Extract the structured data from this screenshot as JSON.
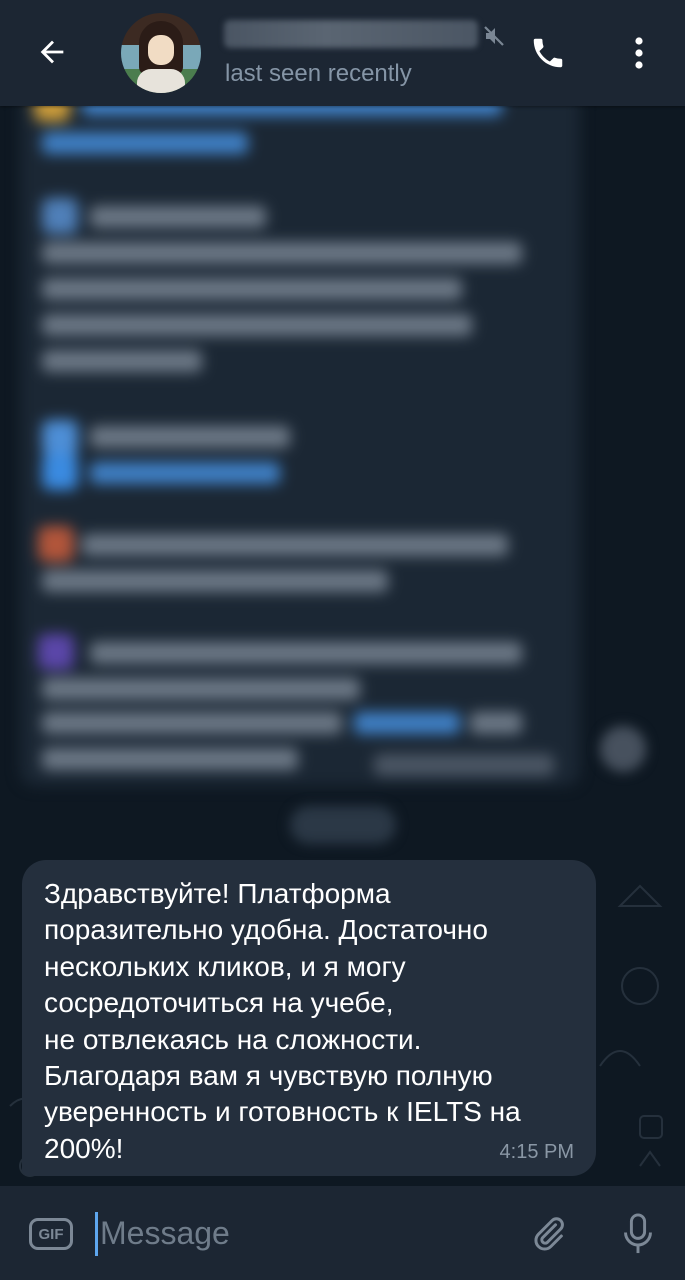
{
  "header": {
    "back_icon": "arrow-left-icon",
    "contact_name": "",
    "status": "last seen recently",
    "muted_icon": "muted-speaker-icon",
    "call_icon": "phone-icon",
    "menu_icon": "more-vertical-icon"
  },
  "chat": {
    "received_message": {
      "text": "Здравствуйте! Платформа\nпоразительно удобна. Достаточно\nнескольких кликов, и я могу\nсосредоточиться на учебе,\nне отвлекаясь на сложности.\nБлагодаря вам я чувствую полную\nуверенность и готовность к IELTS на\n200%!",
      "time": "4:15 PM"
    }
  },
  "composer": {
    "gif_label": "GIF",
    "placeholder": "Message",
    "attach_icon": "paperclip-icon",
    "mic_icon": "microphone-icon"
  },
  "colors": {
    "header_bg": "#1c2633",
    "chat_bg": "#0e1822",
    "bubble_bg": "#242f3d",
    "status_text": "#8595a6",
    "accent": "#5ea6ee"
  }
}
